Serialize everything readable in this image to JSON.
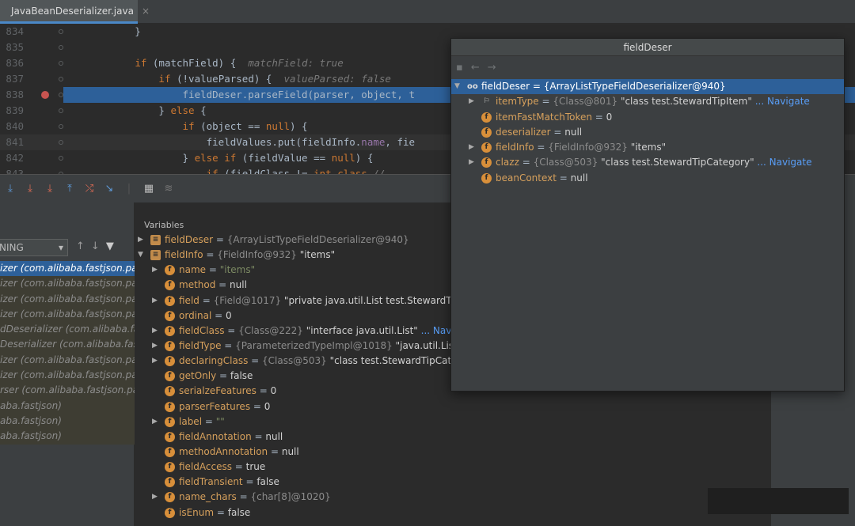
{
  "tab": {
    "filename": "JavaBeanDeserializer.java"
  },
  "editor": {
    "lines": [
      {
        "num": "834",
        "segments": [
          {
            "t": "            }",
            "c": ""
          }
        ]
      },
      {
        "num": "835",
        "segments": []
      },
      {
        "num": "836",
        "segments": [
          {
            "t": "            ",
            "c": ""
          },
          {
            "t": "if",
            "c": "kw"
          },
          {
            "t": " (matchField) {  ",
            "c": ""
          },
          {
            "t": "matchField: true",
            "c": "hint"
          }
        ]
      },
      {
        "num": "837",
        "segments": [
          {
            "t": "                ",
            "c": ""
          },
          {
            "t": "if",
            "c": "kw"
          },
          {
            "t": " (!valueParsed) {  ",
            "c": ""
          },
          {
            "t": "valueParsed: false",
            "c": "hint"
          }
        ]
      },
      {
        "num": "838",
        "segments": [
          {
            "t": "                    fieldDeser.parseField(parser, object, t",
            "c": ""
          }
        ],
        "highlight": true,
        "breakpoint": true
      },
      {
        "num": "839",
        "segments": [
          {
            "t": "                } ",
            "c": ""
          },
          {
            "t": "else",
            "c": "kw"
          },
          {
            "t": " {",
            "c": ""
          }
        ]
      },
      {
        "num": "840",
        "segments": [
          {
            "t": "                    ",
            "c": ""
          },
          {
            "t": "if",
            "c": "kw"
          },
          {
            "t": " (object == ",
            "c": ""
          },
          {
            "t": "null",
            "c": "kw"
          },
          {
            "t": ") {",
            "c": ""
          }
        ]
      },
      {
        "num": "841",
        "segments": [
          {
            "t": "                        fieldValues.put(fieldInfo.",
            "c": ""
          },
          {
            "t": "name",
            "c": "fld"
          },
          {
            "t": ", fie",
            "c": ""
          }
        ],
        "current": true
      },
      {
        "num": "842",
        "segments": [
          {
            "t": "                    } ",
            "c": ""
          },
          {
            "t": "else if",
            "c": "kw"
          },
          {
            "t": " (fieldValue == ",
            "c": ""
          },
          {
            "t": "null",
            "c": "kw"
          },
          {
            "t": ") {",
            "c": ""
          }
        ]
      },
      {
        "num": "843",
        "segments": [
          {
            "t": "                        ",
            "c": ""
          },
          {
            "t": "if",
            "c": "kw"
          },
          {
            "t": " (fieldClass != ",
            "c": ""
          },
          {
            "t": "int",
            "c": "kw"
          },
          {
            "t": ".",
            "c": ""
          },
          {
            "t": "class",
            "c": "kw"
          },
          {
            "t": " //",
            "c": "hint"
          }
        ]
      }
    ]
  },
  "debugger": {
    "thread_selector": "NING",
    "frames": [
      "izer (com.alibaba.fastjson.pa",
      "izer (com.alibaba.fastjson.pa",
      "izer (com.alibaba.fastjson.pa",
      "izer (com.alibaba.fastjson.pa",
      "dDeserializer (com.alibaba.fa",
      "Deserializer (com.alibaba.fas",
      "izer (com.alibaba.fastjson.pa",
      "izer (com.alibaba.fastjson.pa",
      "rser (com.alibaba.fastjson.pa",
      "aba.fastjson)",
      "aba.fastjson)",
      "aba.fastjson)"
    ],
    "variables_title": "Variables",
    "variables": [
      {
        "indent": 0,
        "expand": "▶",
        "icon": "≡",
        "static": true,
        "name": "fieldDeser",
        "op": " = ",
        "type": "{ArrayListTypeFieldDeserializer@940}",
        "value": ""
      },
      {
        "indent": 0,
        "expand": "▼",
        "icon": "≡",
        "static": true,
        "name": "fieldInfo",
        "op": " = ",
        "type": "{FieldInfo@932}",
        "value": " \"items\""
      },
      {
        "indent": 1,
        "expand": "▶",
        "icon": "f",
        "name": "name",
        "op": " = ",
        "type": "",
        "str": "\"items\"",
        "value": ""
      },
      {
        "indent": 1,
        "expand": "",
        "icon": "f",
        "name": "method",
        "op": " = ",
        "type": "",
        "value": "null"
      },
      {
        "indent": 1,
        "expand": "▶",
        "icon": "f",
        "name": "field",
        "op": " = ",
        "type": "{Field@1017}",
        "value": " \"private java.util.List test.StewardTip("
      },
      {
        "indent": 1,
        "expand": "",
        "icon": "f",
        "name": "ordinal",
        "op": " = ",
        "type": "",
        "value": "0"
      },
      {
        "indent": 1,
        "expand": "▶",
        "icon": "f",
        "name": "fieldClass",
        "op": " = ",
        "type": "{Class@222}",
        "value": " \"interface java.util.List\"",
        "nav": " ... Navig"
      },
      {
        "indent": 1,
        "expand": "▶",
        "icon": "f",
        "name": "fieldType",
        "op": " = ",
        "type": "{ParameterizedTypeImpl@1018}",
        "value": " \"java.util.List<"
      },
      {
        "indent": 1,
        "expand": "▶",
        "icon": "f",
        "name": "declaringClass",
        "op": " = ",
        "type": "{Class@503}",
        "value": " \"class test.StewardTipCate"
      },
      {
        "indent": 1,
        "expand": "",
        "icon": "f",
        "name": "getOnly",
        "op": " = ",
        "type": "",
        "value": "false"
      },
      {
        "indent": 1,
        "expand": "",
        "icon": "f",
        "name": "serialzeFeatures",
        "op": " = ",
        "type": "",
        "value": "0"
      },
      {
        "indent": 1,
        "expand": "",
        "icon": "f",
        "name": "parserFeatures",
        "op": " = ",
        "type": "",
        "value": "0"
      },
      {
        "indent": 1,
        "expand": "▶",
        "icon": "f",
        "name": "label",
        "op": " = ",
        "type": "",
        "str": "\"\"",
        "value": ""
      },
      {
        "indent": 1,
        "expand": "",
        "icon": "f",
        "name": "fieldAnnotation",
        "op": " = ",
        "type": "",
        "value": "null"
      },
      {
        "indent": 1,
        "expand": "",
        "icon": "f",
        "name": "methodAnnotation",
        "op": " = ",
        "type": "",
        "value": "null"
      },
      {
        "indent": 1,
        "expand": "",
        "icon": "f",
        "name": "fieldAccess",
        "op": " = ",
        "type": "",
        "value": "true"
      },
      {
        "indent": 1,
        "expand": "",
        "icon": "f",
        "name": "fieldTransient",
        "op": " = ",
        "type": "",
        "value": "false"
      },
      {
        "indent": 1,
        "expand": "▶",
        "icon": "f",
        "name": "name_chars",
        "op": " = ",
        "type": "{char[8]@1020}",
        "value": ""
      },
      {
        "indent": 1,
        "expand": "",
        "icon": "f",
        "name": "isEnum",
        "op": " = ",
        "type": "",
        "value": "false"
      }
    ]
  },
  "popup": {
    "title": "fieldDeser",
    "rows": [
      {
        "indent": 0,
        "expand": "▼",
        "icon": "oo",
        "name": "fieldDeser",
        "op": " = ",
        "type": "{ArrayListTypeFieldDeserializer@940}",
        "value": "",
        "selected": true
      },
      {
        "indent": 1,
        "expand": "▶",
        "icon": "⚐",
        "name": "itemType",
        "op": " = ",
        "type": "{Class@801}",
        "value": " \"class test.StewardTipItem\"",
        "nav": " ... Navigate"
      },
      {
        "indent": 1,
        "expand": "",
        "icon": "f",
        "name": "itemFastMatchToken",
        "op": " = ",
        "type": "",
        "value": "0"
      },
      {
        "indent": 1,
        "expand": "",
        "icon": "f",
        "name": "deserializer",
        "op": " = ",
        "type": "",
        "value": "null"
      },
      {
        "indent": 1,
        "expand": "▶",
        "icon": "f",
        "name": "fieldInfo",
        "op": " = ",
        "type": "{FieldInfo@932}",
        "value": " \"items\""
      },
      {
        "indent": 1,
        "expand": "▶",
        "icon": "f",
        "name": "clazz",
        "op": " = ",
        "type": "{Class@503}",
        "value": " \"class test.StewardTipCategory\"",
        "nav": " ... Navigate"
      },
      {
        "indent": 1,
        "expand": "",
        "icon": "f",
        "name": "beanContext",
        "op": " = ",
        "type": "",
        "value": "null"
      }
    ]
  },
  "colors": {
    "accent": "#2d6099",
    "field_icon": "#d88f3a",
    "keyword": "#cc7832",
    "navigate": "#589df6"
  }
}
